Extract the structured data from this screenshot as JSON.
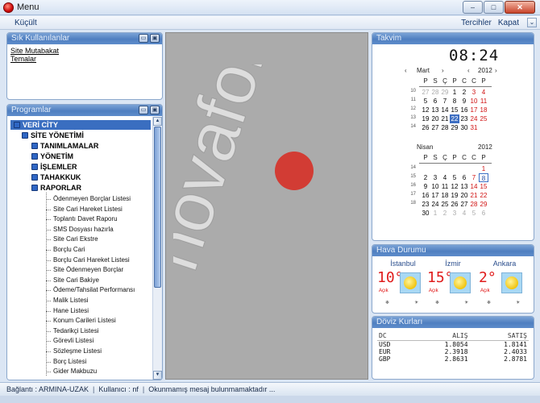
{
  "window": {
    "title": "Menu",
    "minimize": "–",
    "maximize": "□",
    "close": "✕"
  },
  "menubar": {
    "left_label": "Küçült",
    "right_items": [
      "Tercihler",
      "Kapat"
    ],
    "chevron": "⌄"
  },
  "favorites": {
    "title": "Sık Kullanılanlar",
    "items": [
      "Site Mutabakat",
      "Temalar"
    ]
  },
  "programs": {
    "title": "Programlar",
    "root": "VERİ CİTY",
    "site": "SİTE YÖNETİMİ",
    "groups": [
      "TANIMLAMALAR",
      "YÖNETİM",
      "İŞLEMLER",
      "TAHAKKUK",
      "RAPORLAR"
    ],
    "reports": [
      "Ödenmeyen Borçlar Listesi",
      "Site Cari Hareket Listesi",
      "Toplantı Davet Raporu",
      "SMS Dosyası hazırla",
      "Site Cari Ekstre",
      "Borçlu Cari",
      "Borçlu Cari Hareket Listesi",
      "Site Ödenmeyen Borçlar",
      "Site Cari Bakiye",
      "Ödeme/Tahsilat Performansı",
      "Malik Listesi",
      "Hane Listesi",
      "Konum Carileri Listesi",
      "Tedarikçi Listesi",
      "Görevli Listesi",
      "Sözleşme Listesi",
      "Borç Listesi",
      "Gider Makbuzu"
    ]
  },
  "calendar": {
    "title": "Takvim",
    "clock": "08:24",
    "weekday_headers": [
      "P",
      "S",
      "Ç",
      "P",
      "C",
      "C",
      "P"
    ],
    "nav_prev": "‹",
    "nav_next": "›",
    "months": [
      {
        "name": "Mart",
        "year": "2012",
        "weeks": [
          "10",
          "11",
          "12",
          "13",
          "14"
        ],
        "rows": [
          [
            "27",
            "28",
            "29",
            "1",
            "2",
            "3",
            "4"
          ],
          [
            "5",
            "6",
            "7",
            "8",
            "9",
            "10",
            "11"
          ],
          [
            "12",
            "13",
            "14",
            "15",
            "16",
            "17",
            "18"
          ],
          [
            "19",
            "20",
            "21",
            "22",
            "23",
            "24",
            "25"
          ],
          [
            "26",
            "27",
            "28",
            "29",
            "30",
            "31",
            ""
          ]
        ]
      },
      {
        "name": "Nisan",
        "year": "2012",
        "weeks": [
          "14",
          "15",
          "16",
          "17",
          "18"
        ],
        "rows": [
          [
            "",
            "",
            "",
            "",
            "",
            "",
            "1"
          ],
          [
            "2",
            "3",
            "4",
            "5",
            "6",
            "7",
            "8"
          ],
          [
            "9",
            "10",
            "11",
            "12",
            "13",
            "14",
            "15"
          ],
          [
            "16",
            "17",
            "18",
            "19",
            "20",
            "21",
            "22"
          ],
          [
            "23",
            "24",
            "25",
            "26",
            "27",
            "28",
            "29"
          ],
          [
            "30",
            "1",
            "2",
            "3",
            "4",
            "5",
            "6"
          ]
        ]
      }
    ],
    "today": "22",
    "selected": "8"
  },
  "weather": {
    "title": "Hava Durumu",
    "cities": [
      {
        "name": "İstanbul",
        "temp": "10°",
        "desc": "Açık"
      },
      {
        "name": "İzmir",
        "temp": "15°",
        "desc": "Açık"
      },
      {
        "name": "Ankara",
        "temp": "2°",
        "desc": "Açık"
      }
    ]
  },
  "currency": {
    "title": "Döviz Kurları",
    "headers": [
      "DC",
      "ALIŞ",
      "SATIŞ"
    ],
    "rows": [
      [
        "USD",
        "1.8054",
        "1.8141"
      ],
      [
        "EUR",
        "2.3918",
        "2.4033"
      ],
      [
        "GBP",
        "2.8631",
        "2.8781"
      ]
    ]
  },
  "status": {
    "connection": "Bağlantı : ARMINA-UZAK",
    "user": "Kullanıcı : nf",
    "message": "Okunmamış mesaj bulunmamaktadır ..."
  },
  "watermark": "novafortis",
  "colors": {
    "panel_header": "#5e8ccb",
    "accent_red": "#d01010",
    "today_bg": "#3d6ec2"
  }
}
